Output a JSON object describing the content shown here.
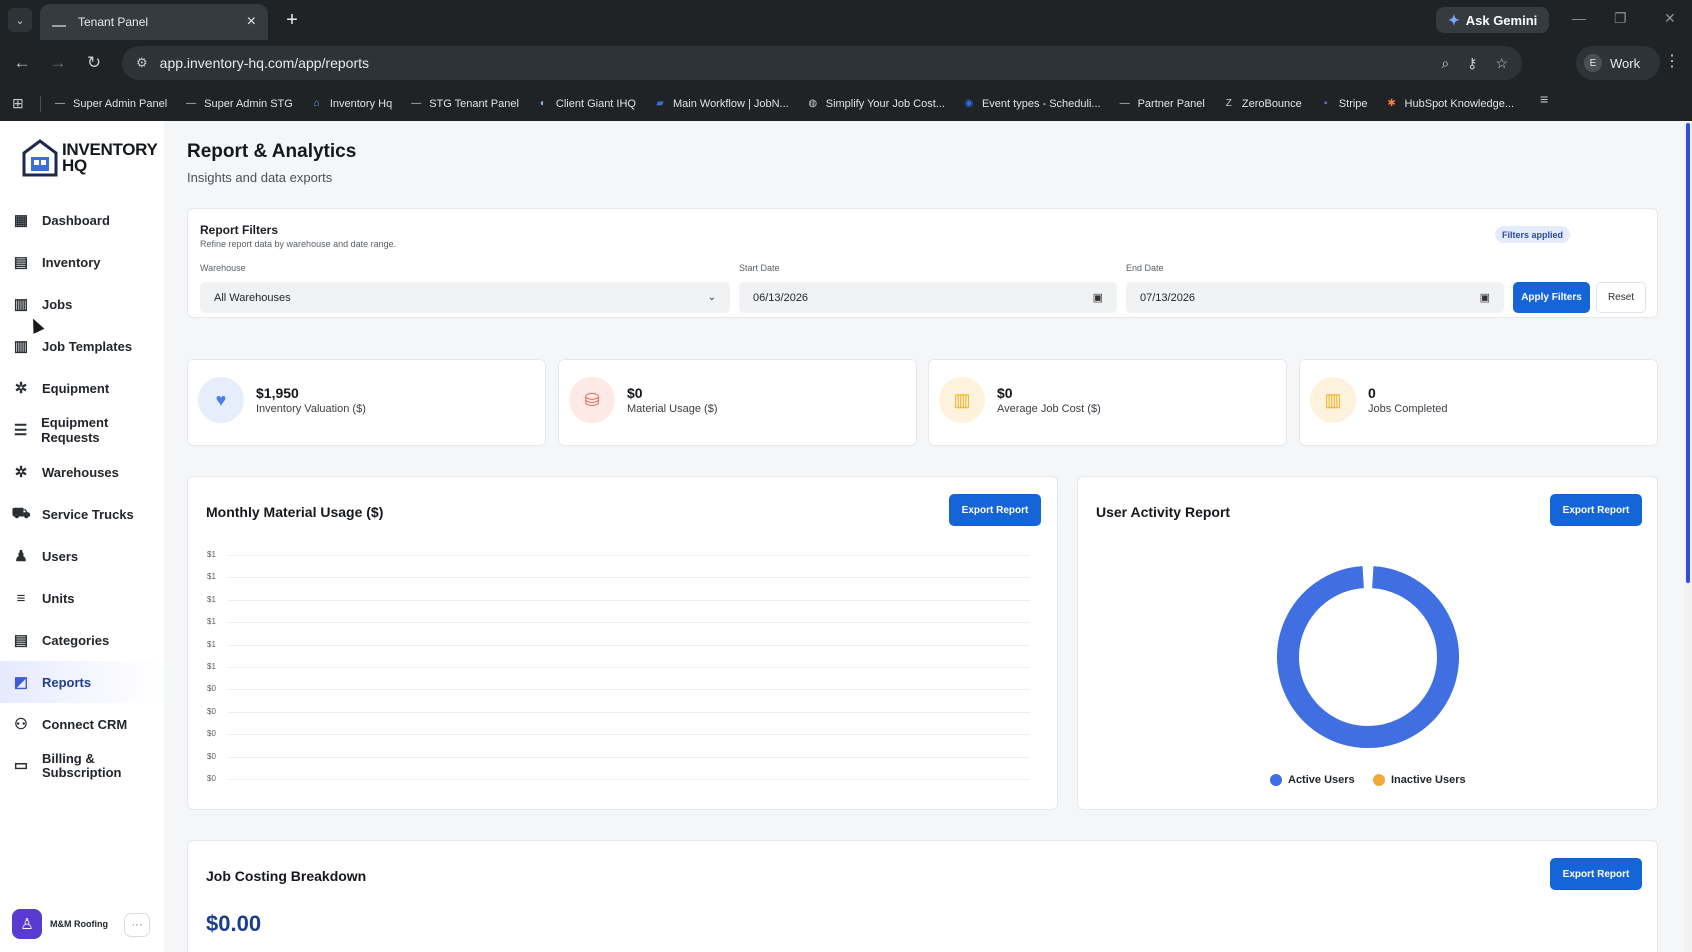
{
  "browser": {
    "tab_title": "Tenant Panel",
    "url": "app.inventory-hq.com/app/reports",
    "ask_gemini": "Ask Gemini",
    "profile_initial": "E",
    "profile_label": "Work",
    "bookmarks": [
      {
        "label": "Super Admin Panel",
        "icon": "dash-icon"
      },
      {
        "label": "Super Admin STG",
        "icon": "dash-icon"
      },
      {
        "label": "Inventory Hq",
        "icon": "house-icon"
      },
      {
        "label": "STG Tenant Panel",
        "icon": "dash-icon"
      },
      {
        "label": "Client Giant IHQ",
        "icon": "circle-icon"
      },
      {
        "label": "Main Workflow | JobN...",
        "icon": "jobnimbus-icon"
      },
      {
        "label": "Simplify Your Job Cost...",
        "icon": "globe-icon"
      },
      {
        "label": "Event types - Scheduli...",
        "icon": "calendly-icon"
      },
      {
        "label": "Partner Panel",
        "icon": "dash-icon"
      },
      {
        "label": "ZeroBounce",
        "icon": "zb-icon"
      },
      {
        "label": "Stripe",
        "icon": "stripe-icon"
      },
      {
        "label": "HubSpot Knowledge...",
        "icon": "hubspot-icon"
      }
    ]
  },
  "sidebar": {
    "logo_line1": "INVENTORY",
    "logo_line2": "HQ",
    "items": [
      {
        "label": "Dashboard",
        "icon": "grid-icon",
        "glyph": "▦"
      },
      {
        "label": "Inventory",
        "icon": "boxes-icon",
        "glyph": "▤"
      },
      {
        "label": "Jobs",
        "icon": "briefcase-icon",
        "glyph": "▥"
      },
      {
        "label": "Job Templates",
        "icon": "template-icon",
        "glyph": "▥"
      },
      {
        "label": "Equipment",
        "icon": "wrench-icon",
        "glyph": "✲"
      },
      {
        "label": "Equipment Requests",
        "icon": "list-icon",
        "glyph": "☰"
      },
      {
        "label": "Warehouses",
        "icon": "warehouse-icon",
        "glyph": "✲"
      },
      {
        "label": "Service Trucks",
        "icon": "truck-icon",
        "glyph": "⛟"
      },
      {
        "label": "Users",
        "icon": "users-icon",
        "glyph": "♟"
      },
      {
        "label": "Units",
        "icon": "units-icon",
        "glyph": "≡"
      },
      {
        "label": "Categories",
        "icon": "categories-icon",
        "glyph": "▤"
      },
      {
        "label": "Reports",
        "icon": "chart-icon",
        "glyph": "◩"
      },
      {
        "label": "Connect CRM",
        "icon": "crm-icon",
        "glyph": "⚇"
      },
      {
        "label": "Billing &",
        "label2": "Subscription",
        "icon": "card-icon",
        "glyph": "▭"
      }
    ],
    "active_index": 11,
    "org_name": "M&M Roofing",
    "org_more": "···"
  },
  "page": {
    "title": "Report & Analytics",
    "subtitle": "Insights and data exports"
  },
  "filters": {
    "title": "Report Filters",
    "subtitle": "Refine report data by warehouse and date range.",
    "badge": "Filters applied",
    "warehouse_label": "Warehouse",
    "warehouse_value": "All Warehouses",
    "start_label": "Start Date",
    "start_value": "06/13/2026",
    "end_label": "End Date",
    "end_value": "07/13/2026",
    "apply": "Apply Filters",
    "reset": "Reset"
  },
  "kpis": [
    {
      "value": "$1,950",
      "label": "Inventory Valuation ($)",
      "icon": "heart-icon",
      "glyph": "♥",
      "color": "#4a7ee8",
      "bg": "#e6eefc"
    },
    {
      "value": "$0",
      "label": "Material Usage ($)",
      "icon": "bag-icon",
      "glyph": "⛁",
      "color": "#e8604a",
      "bg": "#fde9e6"
    },
    {
      "value": "$0",
      "label": "Average Job Cost ($)",
      "icon": "briefcase-icon",
      "glyph": "▥",
      "color": "#f2b01e",
      "bg": "#fdf3dc"
    },
    {
      "value": "0",
      "label": "Jobs Completed",
      "icon": "briefcase-icon",
      "glyph": "▥",
      "color": "#f2b01e",
      "bg": "#fdf3dc"
    }
  ],
  "material_card": {
    "title": "Monthly Material Usage ($)",
    "export": "Export Report"
  },
  "activity_card": {
    "title": "User Activity Report",
    "export": "Export Report",
    "legend_active": "Active Users",
    "legend_inactive": "Inactive Users"
  },
  "costing_card": {
    "title": "Job Costing Breakdown",
    "export": "Export Report",
    "value": "$0.00"
  },
  "colors": {
    "primary": "#1565d8",
    "active_users": "#3f6fe0",
    "inactive_users": "#f2a93b"
  },
  "chart_data": [
    {
      "type": "line",
      "title": "Monthly Material Usage ($)",
      "y_ticks": [
        "$1",
        "$1",
        "$1",
        "$1",
        "$1",
        "$1",
        "$0",
        "$0",
        "$0",
        "$0",
        "$0"
      ],
      "series": [],
      "grid": true
    },
    {
      "type": "pie",
      "title": "User Activity Report",
      "labels": [
        "Active Users",
        "Inactive Users"
      ],
      "values": [
        100,
        0
      ],
      "colors": [
        "#3f6fe0",
        "#f2a93b"
      ],
      "legend": "bottom"
    }
  ]
}
